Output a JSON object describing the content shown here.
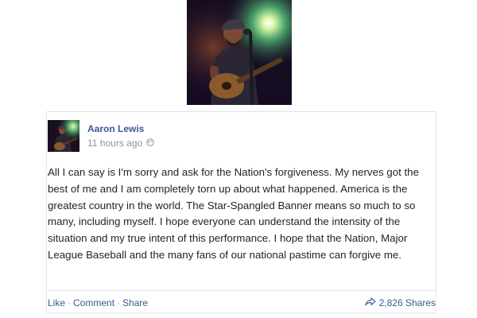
{
  "post": {
    "author_name": "Aaron Lewis",
    "timestamp": "11 hours ago",
    "privacy_icon": "globe-icon",
    "text": "All I can say is I'm sorry and ask for the Nation's forgiveness. My nerves got the best of me and I am completely torn up about what happened. America is the greatest country in the world. The Star-Spangled Banner means so much to so many, including myself. I hope everyone can understand the intensity of the situation and my true intent of this performance. I hope that the Nation, Major League Baseball and the many fans of our national pastime can forgive me."
  },
  "actions": {
    "like": "Like",
    "separator": "·",
    "comment": "Comment",
    "share": "Share"
  },
  "shares": {
    "icon": "share-arrow-icon",
    "label": "2,826 Shares"
  },
  "colors": {
    "link": "#3b5998",
    "meta": "#90949c",
    "body_text": "#1d2129",
    "border": "#e5e6e9"
  }
}
